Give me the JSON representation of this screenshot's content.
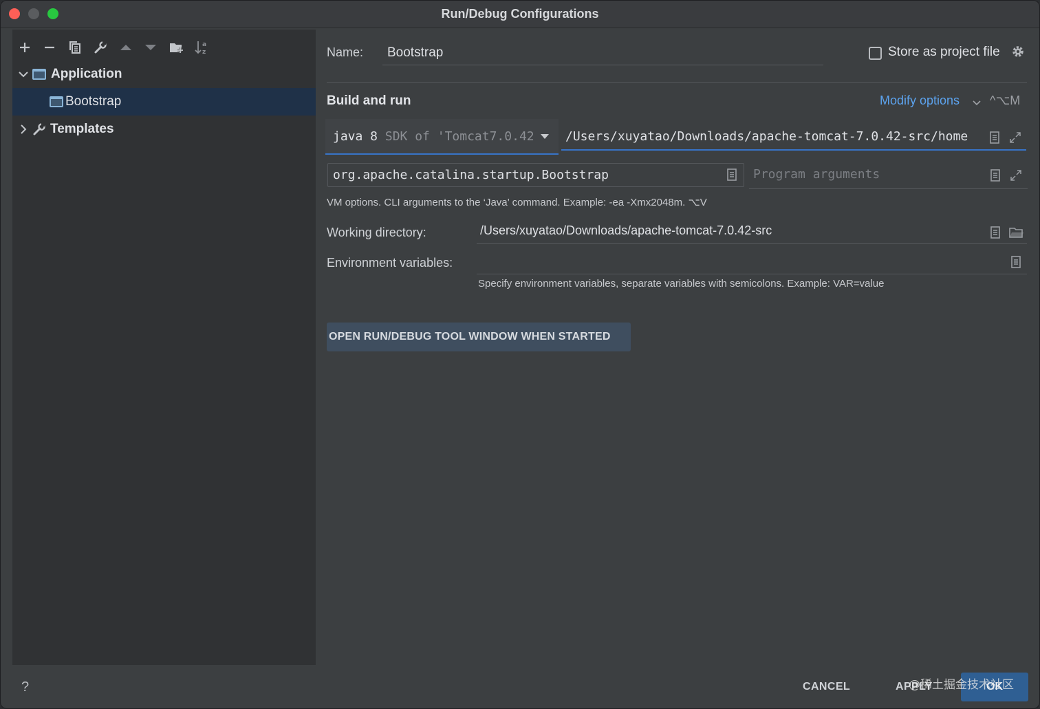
{
  "window": {
    "title": "Run/Debug Configurations"
  },
  "tree": {
    "items": [
      {
        "label": "Application",
        "expanded": true,
        "icon": "application-icon"
      },
      {
        "label": "Bootstrap",
        "selected": true,
        "icon": "application-config-icon"
      },
      {
        "label": "Templates",
        "expanded": false,
        "icon": "wrench-icon"
      }
    ]
  },
  "toolbar": {
    "icons": [
      "add-icon",
      "remove-icon",
      "copy-icon",
      "wrench-icon",
      "move-up-icon",
      "move-down-icon",
      "new-folder-icon",
      "sort-icon"
    ]
  },
  "form": {
    "name_label": "Name:",
    "name_value": "Bootstrap",
    "store_label": "Store as project file",
    "store_checked": false,
    "section_title": "Build and run",
    "modify_options": "Modify options",
    "modify_shortcut": "^⌥M",
    "sdk_main": "java 8",
    "sdk_detail": "SDK of 'Tomcat7.0.42",
    "classpath": "/Users/xuyatao/Downloads/apache-tomcat-7.0.42-src/home",
    "main_class": "org.apache.catalina.startup.Bootstrap",
    "program_args_placeholder": "Program arguments",
    "vm_hint": "VM options. CLI arguments to the ‘Java’ command. Example: -ea -Xmx2048m. ⌥V",
    "working_dir_label": "Working directory:",
    "working_dir_value": "/Users/xuyatao/Downloads/apache-tomcat-7.0.42-src",
    "env_label": "Environment variables:",
    "env_value": "",
    "env_hint": "Specify environment variables, separate variables with semicolons. Example: VAR=value",
    "chip_label": "OPEN RUN/DEBUG TOOL WINDOW WHEN STARTED"
  },
  "footer": {
    "help": "?",
    "cancel": "CANCEL",
    "apply": "APPLY",
    "ok": "OK",
    "watermark": "@稀土掘金技术社区"
  },
  "colors": {
    "accent": "#3874c8",
    "link": "#5ca3ee",
    "selection": "#1f3148",
    "ok_button": "#2f5f93"
  }
}
